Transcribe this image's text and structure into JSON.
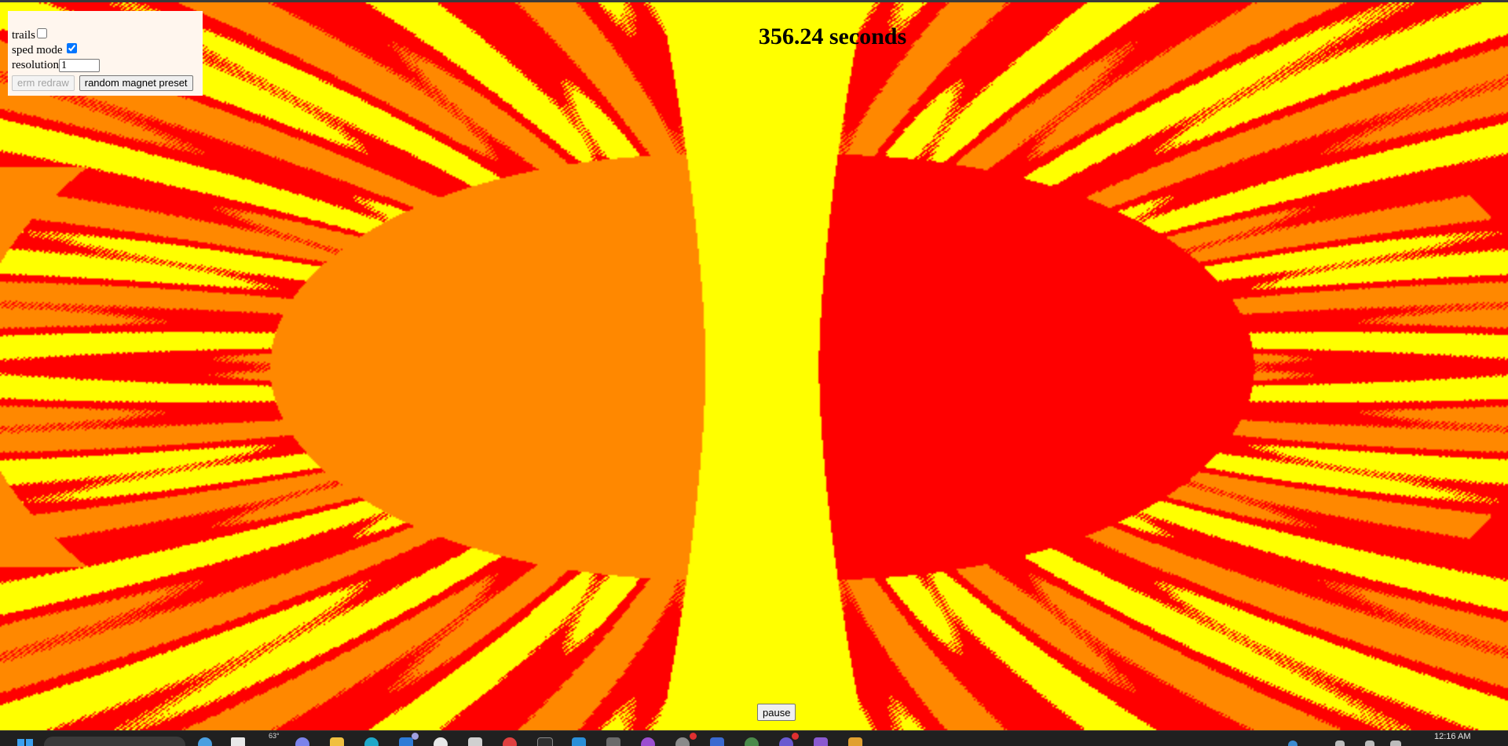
{
  "controls": {
    "trails_label": "trails",
    "trails_checked": false,
    "sped_mode_label": "sped mode",
    "sped_mode_checked": true,
    "resolution_label": "resolution",
    "resolution_value": "1",
    "redraw_label": "erm redraw",
    "redraw_disabled": true,
    "random_preset_label": "random magnet preset"
  },
  "timer": {
    "text": "356.24 seconds"
  },
  "pause_label": "pause",
  "fractal": {
    "colors": {
      "orange": "#ff8800",
      "red": "#ff0000",
      "yellow": "#ffff00"
    }
  },
  "taskbar": {
    "weather": "63°",
    "clock": "12:16 AM",
    "icons": [
      "start-icon",
      "search-icon",
      "widget-icon",
      "task-view-icon",
      "chat-icon",
      "file-explorer-icon",
      "edge-icon",
      "app-icon",
      "terminal-icon",
      "mail-icon",
      "chrome-icon",
      "code-icon",
      "vscode-icon",
      "app-icon",
      "app-icon",
      "app-icon",
      "app-icon",
      "app-icon",
      "app-icon",
      "app-icon"
    ],
    "tray_icons": [
      "network-icon",
      "volume-icon",
      "battery-icon",
      "notifications-icon"
    ]
  }
}
